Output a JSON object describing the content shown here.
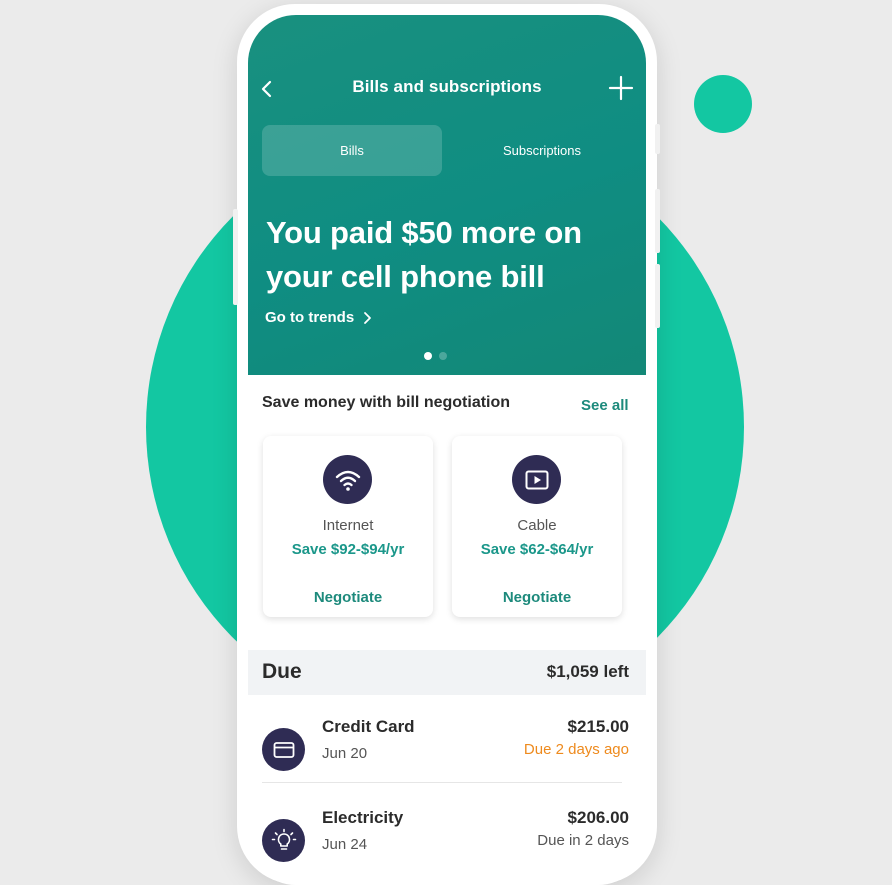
{
  "header": {
    "title": "Bills and subscriptions"
  },
  "tabs": [
    {
      "label": "Bills",
      "active": true
    },
    {
      "label": "Subscriptions",
      "active": false
    }
  ],
  "hero": {
    "headline": "You paid $50 more on your cell phone bill",
    "link": "Go to trends",
    "pager": {
      "count": 2,
      "active_index": 0
    }
  },
  "negotiation": {
    "title": "Save money with bill negotiation",
    "see_all": "See all",
    "offers": [
      {
        "name": "Internet",
        "savings": "Save $92-$94/yr",
        "action": "Negotiate",
        "icon": "wifi-icon"
      },
      {
        "name": "Cable",
        "savings": "Save $62-$64/yr",
        "action": "Negotiate",
        "icon": "play-icon"
      }
    ]
  },
  "due": {
    "label": "Due",
    "left": "$1,059 left",
    "bills": [
      {
        "name": "Credit Card",
        "date": "Jun 20",
        "amount": "$215.00",
        "status": "Due 2 days ago",
        "icon": "credit-card-icon"
      },
      {
        "name": "Electricity",
        "date": "Jun 24",
        "amount": "$206.00",
        "status": "Due in 2 days",
        "icon": "lightbulb-icon"
      }
    ]
  },
  "colors": {
    "accent": "#13c7a2",
    "header": "#0f8d82",
    "link": "#1d8a7c",
    "icon_bg": "#2f2c54",
    "overdue": "#ee8a1d"
  }
}
